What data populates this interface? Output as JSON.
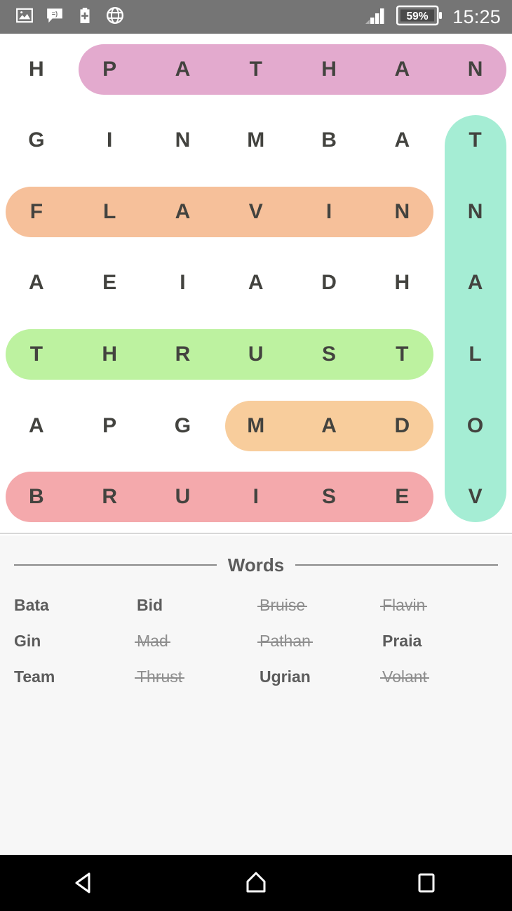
{
  "status_bar": {
    "background": "#757575",
    "icons": [
      {
        "name": "photo-icon",
        "label": "Screenshot saved"
      },
      {
        "name": "message-icon",
        "label": "Message"
      },
      {
        "name": "battery-plus-icon",
        "label": "Battery saver"
      },
      {
        "name": "globe-icon",
        "label": "Network"
      }
    ],
    "signal": {
      "name": "signal-bars-icon",
      "bars_total": 4,
      "bars_active": 3
    },
    "battery": {
      "name": "battery-icon",
      "level_text": "59%"
    },
    "clock": "15:25"
  },
  "game": {
    "grid": {
      "rows": 7,
      "cols": 7,
      "letters": [
        [
          "H",
          "P",
          "A",
          "T",
          "H",
          "A",
          "N"
        ],
        [
          "G",
          "I",
          "N",
          "M",
          "B",
          "A",
          "T"
        ],
        [
          "F",
          "L",
          "A",
          "V",
          "I",
          "N",
          "N"
        ],
        [
          "A",
          "E",
          "I",
          "A",
          "D",
          "H",
          "A"
        ],
        [
          "T",
          "H",
          "R",
          "U",
          "S",
          "T",
          "L"
        ],
        [
          "A",
          "P",
          "G",
          "M",
          "A",
          "D",
          "O"
        ],
        [
          "B",
          "R",
          "U",
          "I",
          "S",
          "E",
          "V"
        ]
      ],
      "letter_color": "#43433f",
      "background": "#ffffff"
    },
    "highlights": [
      {
        "word": "Pathan",
        "color": "#e3aace",
        "orientation": "horizontal",
        "row": 0,
        "col_start": 1,
        "col_end": 6
      },
      {
        "word": "Volant",
        "color": "#a5edd4",
        "orientation": "vertical",
        "col": 6,
        "row_start": 1,
        "row_end": 6
      },
      {
        "word": "Flavin",
        "color": "#f6c09a",
        "orientation": "horizontal",
        "row": 2,
        "col_start": 0,
        "col_end": 5
      },
      {
        "word": "Thrust",
        "color": "#bdf2a0",
        "orientation": "horizontal",
        "row": 4,
        "col_start": 0,
        "col_end": 5
      },
      {
        "word": "Mad",
        "color": "#f8cd9c",
        "orientation": "horizontal",
        "row": 5,
        "col_start": 3,
        "col_end": 5
      },
      {
        "word": "Bruise",
        "color": "#f4a9ac",
        "orientation": "horizontal",
        "row": 6,
        "col_start": 0,
        "col_end": 5
      }
    ]
  },
  "words_panel": {
    "title": "Words",
    "background": "#f7f7f7",
    "rows": [
      [
        {
          "text": "Bata",
          "found": false
        },
        {
          "text": "Bid",
          "found": false
        },
        {
          "text": "Bruise",
          "found": true
        },
        {
          "text": "Flavin",
          "found": true
        }
      ],
      [
        {
          "text": "Gin",
          "found": false
        },
        {
          "text": "Mad",
          "found": true
        },
        {
          "text": "Pathan",
          "found": true
        },
        {
          "text": "Praia",
          "found": false
        }
      ],
      [
        {
          "text": "Team",
          "found": false
        },
        {
          "text": "Thrust",
          "found": true
        },
        {
          "text": "Ugrian",
          "found": false
        },
        {
          "text": "Volant",
          "found": true
        }
      ]
    ]
  },
  "nav_bar": {
    "background": "#000000",
    "buttons": [
      {
        "name": "back-button",
        "label": "Back"
      },
      {
        "name": "home-button",
        "label": "Home"
      },
      {
        "name": "recents-button",
        "label": "Recents"
      }
    ]
  }
}
